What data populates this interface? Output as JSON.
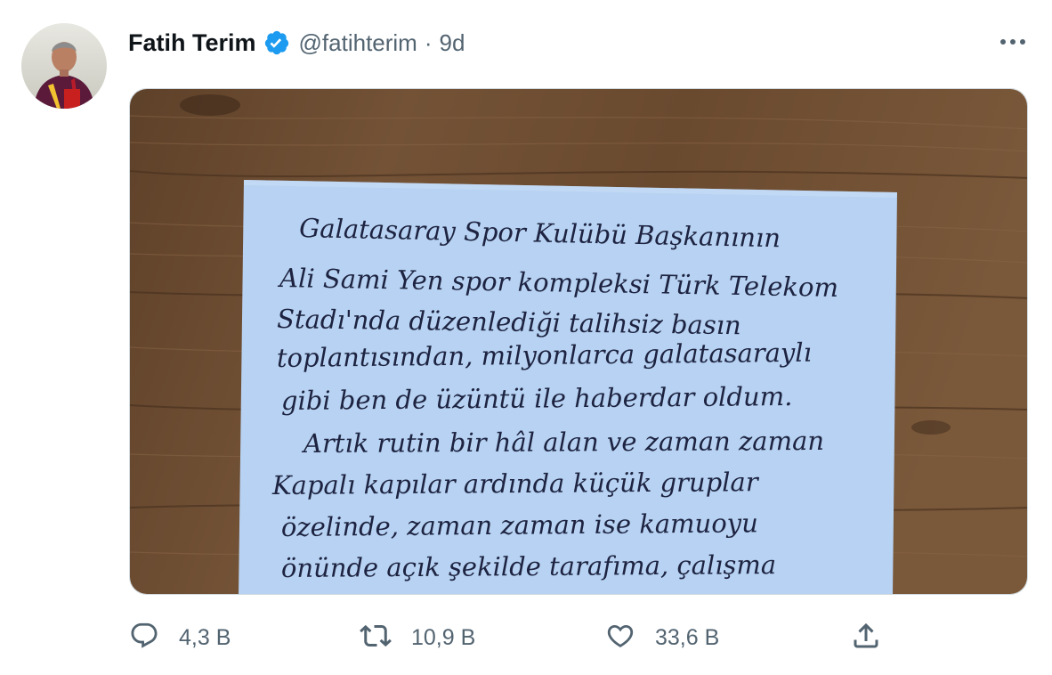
{
  "tweet": {
    "author": {
      "name": "Fatih Terim",
      "handle": "@fatihterim",
      "verified": true,
      "avatar_icon": "profile-photo"
    },
    "separator": "·",
    "time": "9d",
    "more_icon": "more-icon",
    "media": {
      "type": "photo",
      "description_icon": "handwritten-letter-photo",
      "handwritten_lines": [
        "Galatasaray Spor Kulübü Başkanının",
        "Ali Sami Yen spor kompleksi Türk Telekom",
        "Stadı'nda düzenlediği talihsiz basın",
        "toplantısından, milyonlarca galatasaraylı",
        "gibi ben de üzüntü ile haberdar oldum.",
        "Artık rutin bir hâl alan ve zaman zaman",
        "Kapalı kapılar ardında küçük gruplar",
        "özelinde, zaman zaman ise kamuoyu",
        "önünde açık şekilde tarafıma, çalışma"
      ]
    },
    "actions": {
      "reply": {
        "icon": "reply-icon",
        "count": "4,3 B"
      },
      "retweet": {
        "icon": "retweet-icon",
        "count": "10,9 B"
      },
      "like": {
        "icon": "heart-icon",
        "count": "33,6 B"
      },
      "share": {
        "icon": "share-icon"
      }
    },
    "colors": {
      "text_primary": "#0f1419",
      "text_secondary": "#536471",
      "verified_blue": "#1d9bf0",
      "paper": "#b7d2f2",
      "ink": "#1d2340",
      "wood": "#6b4a2e"
    }
  }
}
